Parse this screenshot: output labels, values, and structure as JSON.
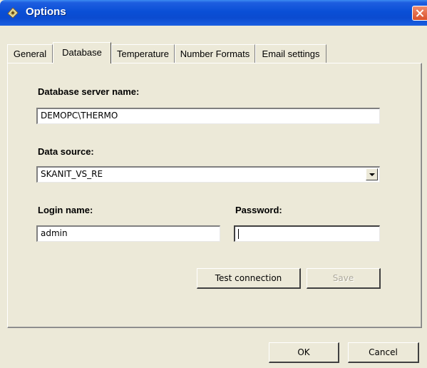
{
  "window": {
    "title": "Options"
  },
  "tabs": [
    {
      "label": "General"
    },
    {
      "label": "Database"
    },
    {
      "label": "Temperature"
    },
    {
      "label": "Number Formats"
    },
    {
      "label": "Email settings"
    }
  ],
  "active_tab": "Database",
  "database": {
    "server_label": "Database server name:",
    "server_value": "DEMOPC\\THERMO",
    "source_label": "Data source:",
    "source_value": "SKANIT_VS_RE",
    "login_label": "Login name:",
    "login_value": "admin",
    "password_label": "Password:",
    "password_value": "",
    "test_button": "Test connection",
    "save_button": "Save"
  },
  "footer": {
    "ok_button": "OK",
    "cancel_button": "Cancel"
  },
  "colors": {
    "titlebar": "#0a4fd6",
    "dialog_bg": "#ece9d8",
    "close_button": "#d9502a"
  },
  "icons": {
    "app": "options-app-icon",
    "close": "close-icon",
    "dropdown": "chevron-down-icon"
  }
}
